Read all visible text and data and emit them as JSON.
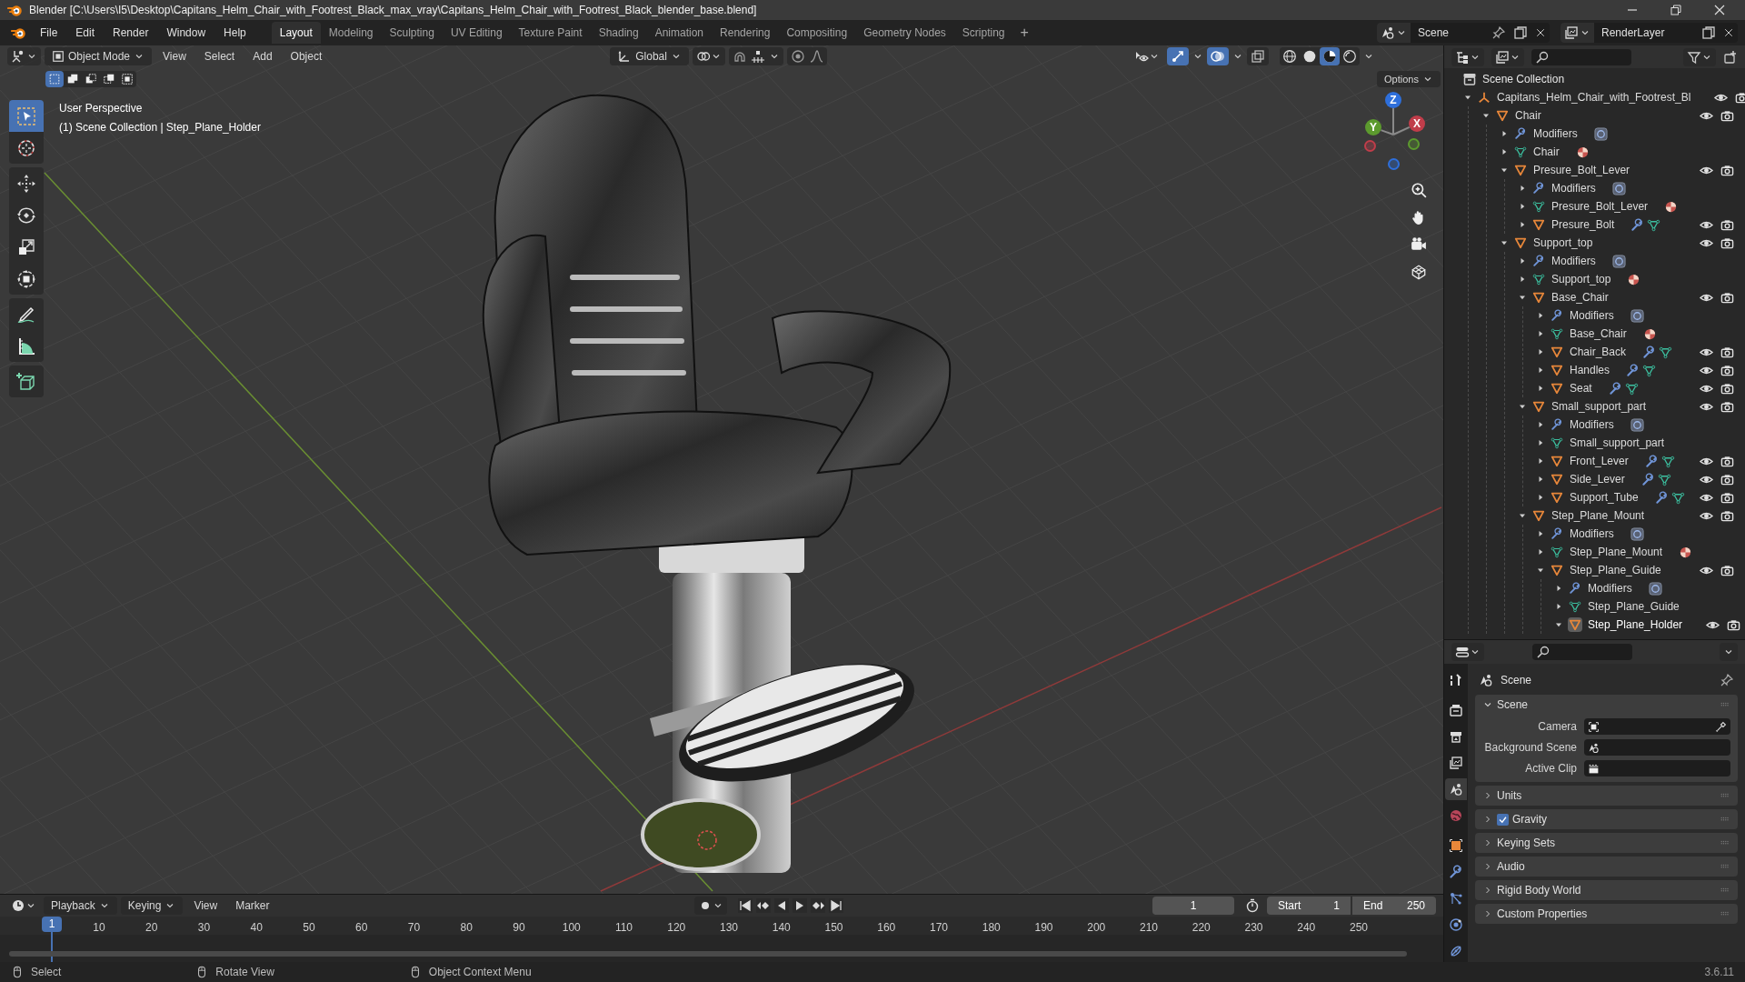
{
  "window": {
    "title": "Blender [C:\\Users\\I5\\Desktop\\Capitans_Helm_Chair_with_Footrest_Black_max_vray\\Capitans_Helm_Chair_with_Footrest_Black_blender_base.blend]"
  },
  "menu": [
    "File",
    "Edit",
    "Render",
    "Window",
    "Help"
  ],
  "workspaces": [
    {
      "label": "Layout",
      "selected": true
    },
    {
      "label": "Modeling",
      "selected": false
    },
    {
      "label": "Sculpting",
      "selected": false
    },
    {
      "label": "UV Editing",
      "selected": false
    },
    {
      "label": "Texture Paint",
      "selected": false
    },
    {
      "label": "Shading",
      "selected": false
    },
    {
      "label": "Animation",
      "selected": false
    },
    {
      "label": "Rendering",
      "selected": false
    },
    {
      "label": "Compositing",
      "selected": false
    },
    {
      "label": "Geometry Nodes",
      "selected": false
    },
    {
      "label": "Scripting",
      "selected": false
    }
  ],
  "add_workspace": "+",
  "scene_selector": {
    "value": "Scene"
  },
  "view_layer_selector": {
    "value": "RenderLayer"
  },
  "viewport": {
    "mode": "Object Mode",
    "menus": [
      "View",
      "Select",
      "Add",
      "Object"
    ],
    "orientation": "Global",
    "options": "Options",
    "header_toggles": [
      {
        "kind": "gizmos",
        "on": true
      },
      {
        "kind": "overlays",
        "on": true
      },
      {
        "kind": "xray",
        "on": false
      }
    ],
    "shading_modes": [
      {
        "kind": "wireframe",
        "selected": false
      },
      {
        "kind": "solid",
        "selected": false
      },
      {
        "kind": "material",
        "selected": true
      },
      {
        "kind": "rendered",
        "selected": false
      }
    ],
    "select_modes": [
      {
        "kind": "new",
        "selected": true
      },
      {
        "kind": "extend",
        "selected": false
      },
      {
        "kind": "subtract",
        "selected": false
      },
      {
        "kind": "invert",
        "selected": false
      },
      {
        "kind": "intersect",
        "selected": false
      }
    ],
    "overlay_text": [
      "User Perspective",
      "(1) Scene Collection | Step_Plane_Holder"
    ],
    "tools": [
      {
        "kind": "select_box",
        "selected": true
      },
      {
        "kind": "cursor",
        "selected": false
      },
      {
        "kind": "move",
        "selected": false
      },
      {
        "kind": "rotate",
        "selected": false
      },
      {
        "kind": "scale",
        "selected": false
      },
      {
        "kind": "transform",
        "selected": false
      },
      {
        "kind": "annotate",
        "selected": false
      },
      {
        "kind": "measure",
        "selected": false
      },
      {
        "kind": "add_cube",
        "selected": false
      }
    ],
    "gizmo_axes": [
      "Z",
      "Y",
      "X"
    ]
  },
  "outliner": {
    "root": "Scene Collection",
    "items": [
      {
        "name": "Capitans_Helm_Chair_with_Footrest_Bl",
        "kind": "empty",
        "expanded": true,
        "toggles": true,
        "selected": false,
        "children": [
          {
            "name": "Chair",
            "kind": "object",
            "expanded": true,
            "toggles": true,
            "selected": false,
            "children": [
              {
                "name": "Modifiers",
                "kind": "modifiers",
                "expanded": false,
                "toggles": false,
                "selected": false,
                "stack_badge": true
              },
              {
                "name": "Chair",
                "kind": "mesh",
                "expanded": false,
                "toggles": false,
                "selected": false,
                "material_badge": true
              },
              {
                "name": "Presure_Bolt_Lever",
                "kind": "object",
                "expanded": true,
                "toggles": true,
                "selected": false,
                "children": [
                  {
                    "name": "Modifiers",
                    "kind": "modifiers",
                    "expanded": false,
                    "toggles": false,
                    "selected": false,
                    "stack_badge": true
                  },
                  {
                    "name": "Presure_Bolt_Lever",
                    "kind": "mesh",
                    "expanded": false,
                    "toggles": false,
                    "selected": false,
                    "material_badge": true
                  },
                  {
                    "name": "Presure_Bolt",
                    "kind": "object",
                    "expanded": false,
                    "toggles": true,
                    "selected": false,
                    "data_badges": true
                  }
                ]
              },
              {
                "name": "Support_top",
                "kind": "object",
                "expanded": true,
                "toggles": true,
                "selected": false,
                "children": [
                  {
                    "name": "Modifiers",
                    "kind": "modifiers",
                    "expanded": false,
                    "toggles": false,
                    "selected": false,
                    "stack_badge": true
                  },
                  {
                    "name": "Support_top",
                    "kind": "mesh",
                    "expanded": false,
                    "toggles": false,
                    "selected": false,
                    "material_badge": true
                  },
                  {
                    "name": "Base_Chair",
                    "kind": "object",
                    "expanded": true,
                    "toggles": true,
                    "selected": false,
                    "children": [
                      {
                        "name": "Modifiers",
                        "kind": "modifiers",
                        "expanded": false,
                        "toggles": false,
                        "selected": false,
                        "stack_badge": true
                      },
                      {
                        "name": "Base_Chair",
                        "kind": "mesh",
                        "expanded": false,
                        "toggles": false,
                        "selected": false,
                        "material_badge": true
                      },
                      {
                        "name": "Chair_Back",
                        "kind": "object",
                        "expanded": false,
                        "toggles": true,
                        "selected": false,
                        "data_badges": true
                      },
                      {
                        "name": "Handles",
                        "kind": "object",
                        "expanded": false,
                        "toggles": true,
                        "selected": false,
                        "data_badges": true
                      },
                      {
                        "name": "Seat",
                        "kind": "object",
                        "expanded": false,
                        "toggles": true,
                        "selected": false,
                        "data_badges": true
                      }
                    ]
                  },
                  {
                    "name": "Small_support_part",
                    "kind": "object",
                    "expanded": true,
                    "toggles": true,
                    "selected": false,
                    "children": [
                      {
                        "name": "Modifiers",
                        "kind": "modifiers",
                        "expanded": false,
                        "toggles": false,
                        "selected": false,
                        "stack_badge": true
                      },
                      {
                        "name": "Small_support_part",
                        "kind": "mesh",
                        "expanded": false,
                        "toggles": false,
                        "selected": false
                      },
                      {
                        "name": "Front_Lever",
                        "kind": "object",
                        "expanded": false,
                        "toggles": true,
                        "selected": false,
                        "data_badges": true
                      },
                      {
                        "name": "Side_Lever",
                        "kind": "object",
                        "expanded": false,
                        "toggles": true,
                        "selected": false,
                        "data_badges": true
                      },
                      {
                        "name": "Support_Tube",
                        "kind": "object",
                        "expanded": false,
                        "toggles": true,
                        "selected": false,
                        "data_badges": true
                      }
                    ]
                  },
                  {
                    "name": "Step_Plane_Mount",
                    "kind": "object",
                    "expanded": true,
                    "toggles": true,
                    "selected": false,
                    "children": [
                      {
                        "name": "Modifiers",
                        "kind": "modifiers",
                        "expanded": false,
                        "toggles": false,
                        "selected": false,
                        "stack_badge": true
                      },
                      {
                        "name": "Step_Plane_Mount",
                        "kind": "mesh",
                        "expanded": false,
                        "toggles": false,
                        "selected": false,
                        "material_badge": true
                      },
                      {
                        "name": "Step_Plane_Guide",
                        "kind": "object",
                        "expanded": true,
                        "toggles": true,
                        "selected": false,
                        "children": [
                          {
                            "name": "Modifiers",
                            "kind": "modifiers",
                            "expanded": false,
                            "toggles": false,
                            "selected": false,
                            "stack_badge": true
                          },
                          {
                            "name": "Step_Plane_Guide",
                            "kind": "mesh",
                            "expanded": false,
                            "toggles": false,
                            "selected": false
                          },
                          {
                            "name": "Step_Plane_Holder",
                            "kind": "object",
                            "expanded": true,
                            "toggles": true,
                            "selected": true
                          }
                        ]
                      }
                    ]
                  }
                ]
              }
            ]
          }
        ]
      }
    ]
  },
  "properties": {
    "tabs": [
      {
        "kind": "tool",
        "selected": false
      },
      {
        "kind": "render",
        "selected": false
      },
      {
        "kind": "output",
        "selected": false
      },
      {
        "kind": "view_layer",
        "selected": false
      },
      {
        "kind": "scene",
        "selected": true
      },
      {
        "kind": "world",
        "selected": false
      },
      {
        "kind": "object",
        "selected": false
      },
      {
        "kind": "modifiers",
        "selected": false
      },
      {
        "kind": "particles",
        "selected": false
      },
      {
        "kind": "physics",
        "selected": false
      },
      {
        "kind": "constraints",
        "selected": false
      }
    ],
    "context": "Scene",
    "panels": [
      {
        "title": "Scene",
        "expanded": true,
        "fields": [
          {
            "label": "Camera",
            "kind": "camera"
          },
          {
            "label": "Background Scene",
            "kind": "scene"
          },
          {
            "label": "Active Clip",
            "kind": "clip"
          }
        ]
      },
      {
        "title": "Units",
        "expanded": false
      },
      {
        "title": "Gravity",
        "expanded": false,
        "checked": true
      },
      {
        "title": "Keying Sets",
        "expanded": false
      },
      {
        "title": "Audio",
        "expanded": false
      },
      {
        "title": "Rigid Body World",
        "expanded": false
      },
      {
        "title": "Custom Properties",
        "expanded": false
      }
    ]
  },
  "timeline": {
    "menus": [
      "Playback",
      "Keying",
      "View",
      "Marker"
    ],
    "current_frame": "1",
    "start_label": "Start",
    "start": "1",
    "end_label": "End",
    "end": "250",
    "playhead": "1",
    "ruler": [
      "10",
      "20",
      "30",
      "40",
      "50",
      "60",
      "70",
      "80",
      "90",
      "100",
      "110",
      "120",
      "130",
      "140",
      "150",
      "160",
      "170",
      "180",
      "190",
      "200",
      "210",
      "220",
      "230",
      "240",
      "250"
    ]
  },
  "status_bar": {
    "hints": [
      "Select",
      "Rotate View",
      "Object Context Menu"
    ],
    "version": "3.6.11"
  }
}
